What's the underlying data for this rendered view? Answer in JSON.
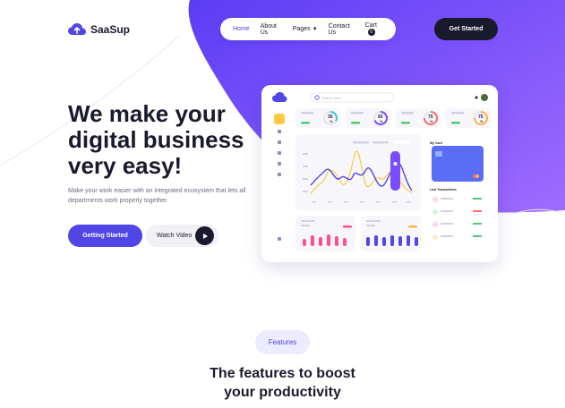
{
  "logo": {
    "text": "SaaSup"
  },
  "nav": {
    "items": [
      {
        "label": "Home",
        "active": true
      },
      {
        "label": "About Us"
      },
      {
        "label": "Pages"
      },
      {
        "label": "Contact Us"
      },
      {
        "label": "Cart"
      }
    ],
    "cart_count": "0",
    "cta_label": "Get Started"
  },
  "hero": {
    "title_line1": "We make your",
    "title_line2": "digital business",
    "title_line3": "very easy!",
    "subtitle": "Make your work easier with an integrated ecosystem that lets all departments work properly together.",
    "primary_label": "Getting Started",
    "video_label": "Watch Video"
  },
  "dashboard": {
    "search_placeholder": "Search here",
    "stats": [
      "35",
      "65",
      "75",
      "75"
    ],
    "stat_suffix": "%",
    "card_title": "My Card",
    "transactions_title": "Last Transactions"
  },
  "features": {
    "pill": "Features",
    "title_line1": "The features to boost",
    "title_line2": "your productivity"
  },
  "colors": {
    "accent": "#4f46e5",
    "purple_bg": "#6d4aff",
    "dark": "#1a1a2e"
  }
}
